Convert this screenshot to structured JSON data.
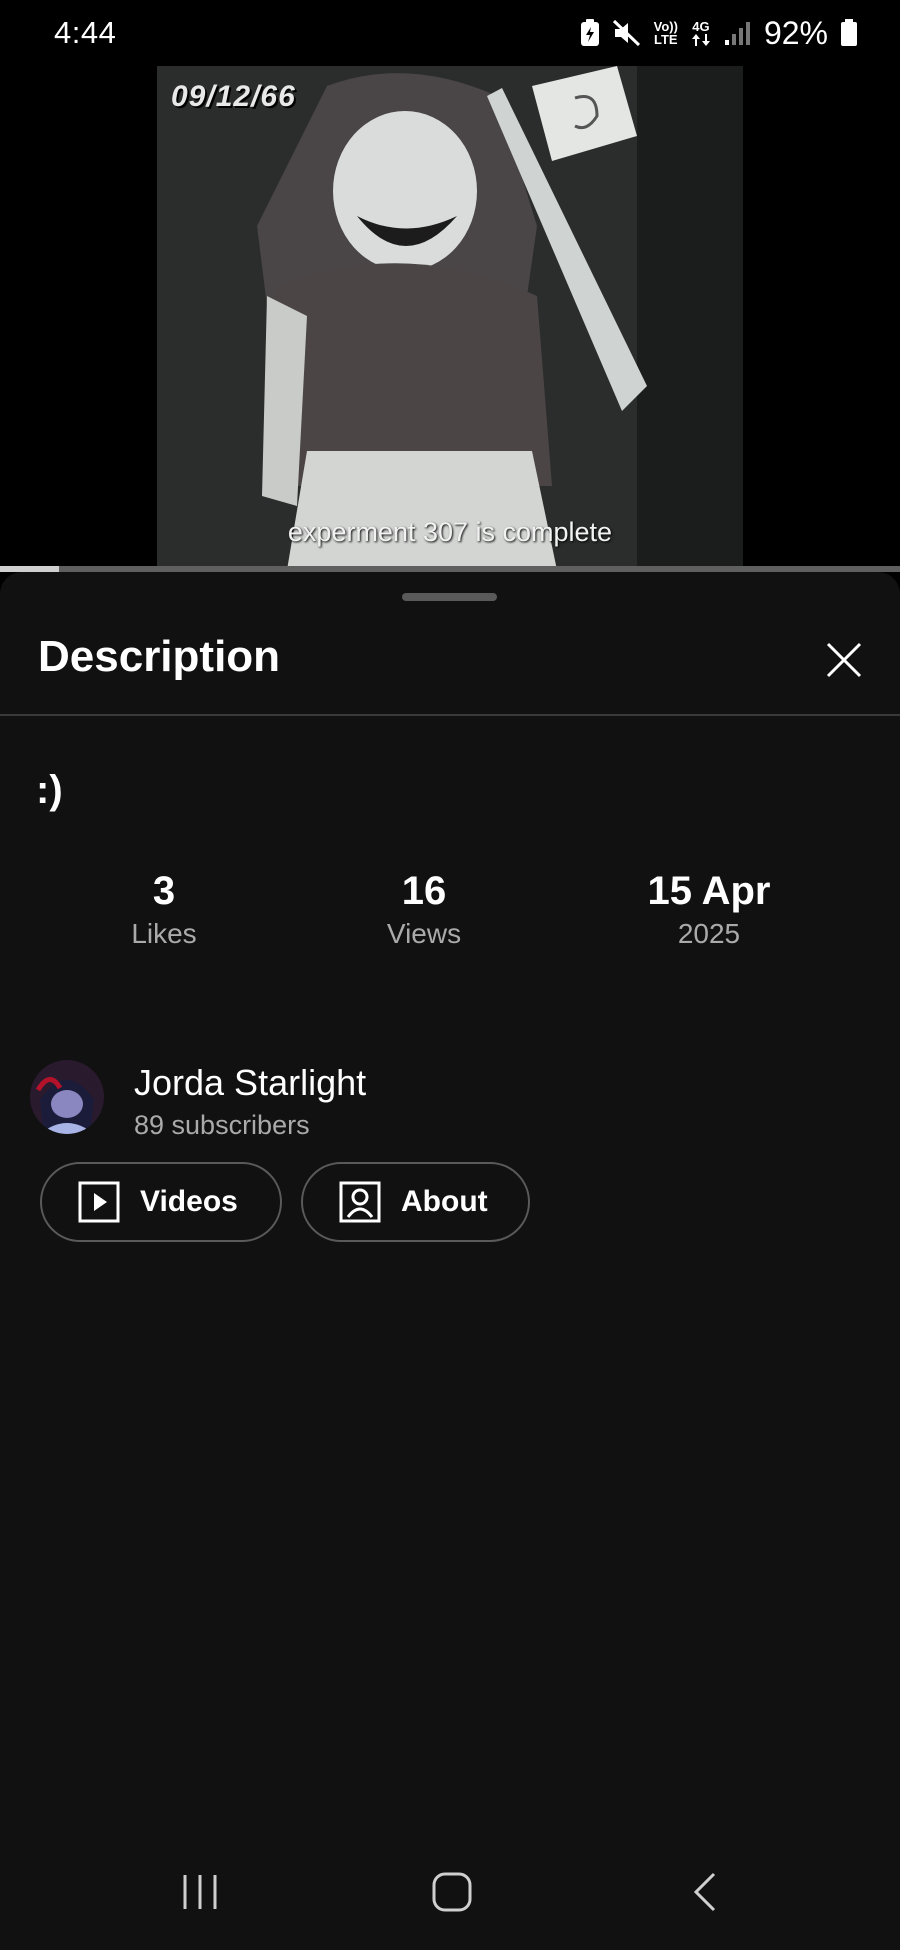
{
  "status_bar": {
    "time": "4:44",
    "network_top": "Vo))",
    "network_bottom": "LTE",
    "network_type": "4G",
    "battery_percent": "92%",
    "icons": [
      "battery-saver-icon",
      "mute-icon",
      "volte-icon",
      "data-arrows-icon",
      "signal-icon",
      "battery-icon"
    ]
  },
  "video": {
    "overlay_date": "09/12/66",
    "caption": "experment 307 is complete",
    "progress_fraction": 0.065
  },
  "description_sheet": {
    "title": "Description",
    "description_text": ":)",
    "stats": [
      {
        "value": "3",
        "label": "Likes"
      },
      {
        "value": "16",
        "label": "Views"
      },
      {
        "value": "15 Apr",
        "label": "2025"
      }
    ],
    "channel": {
      "name": "Jorda Starlight",
      "subscribers": "89 subscribers"
    },
    "buttons": {
      "videos_label": "Videos",
      "about_label": "About"
    }
  },
  "navigation": {
    "icons": [
      "recent-apps-icon",
      "home-icon",
      "back-icon"
    ]
  },
  "colors": {
    "background": "#111111",
    "status_bar_background": "#000000",
    "secondary_text": "#aaaaaa",
    "divider": "#3a3a3a",
    "pill_border": "#5a5a5a"
  }
}
